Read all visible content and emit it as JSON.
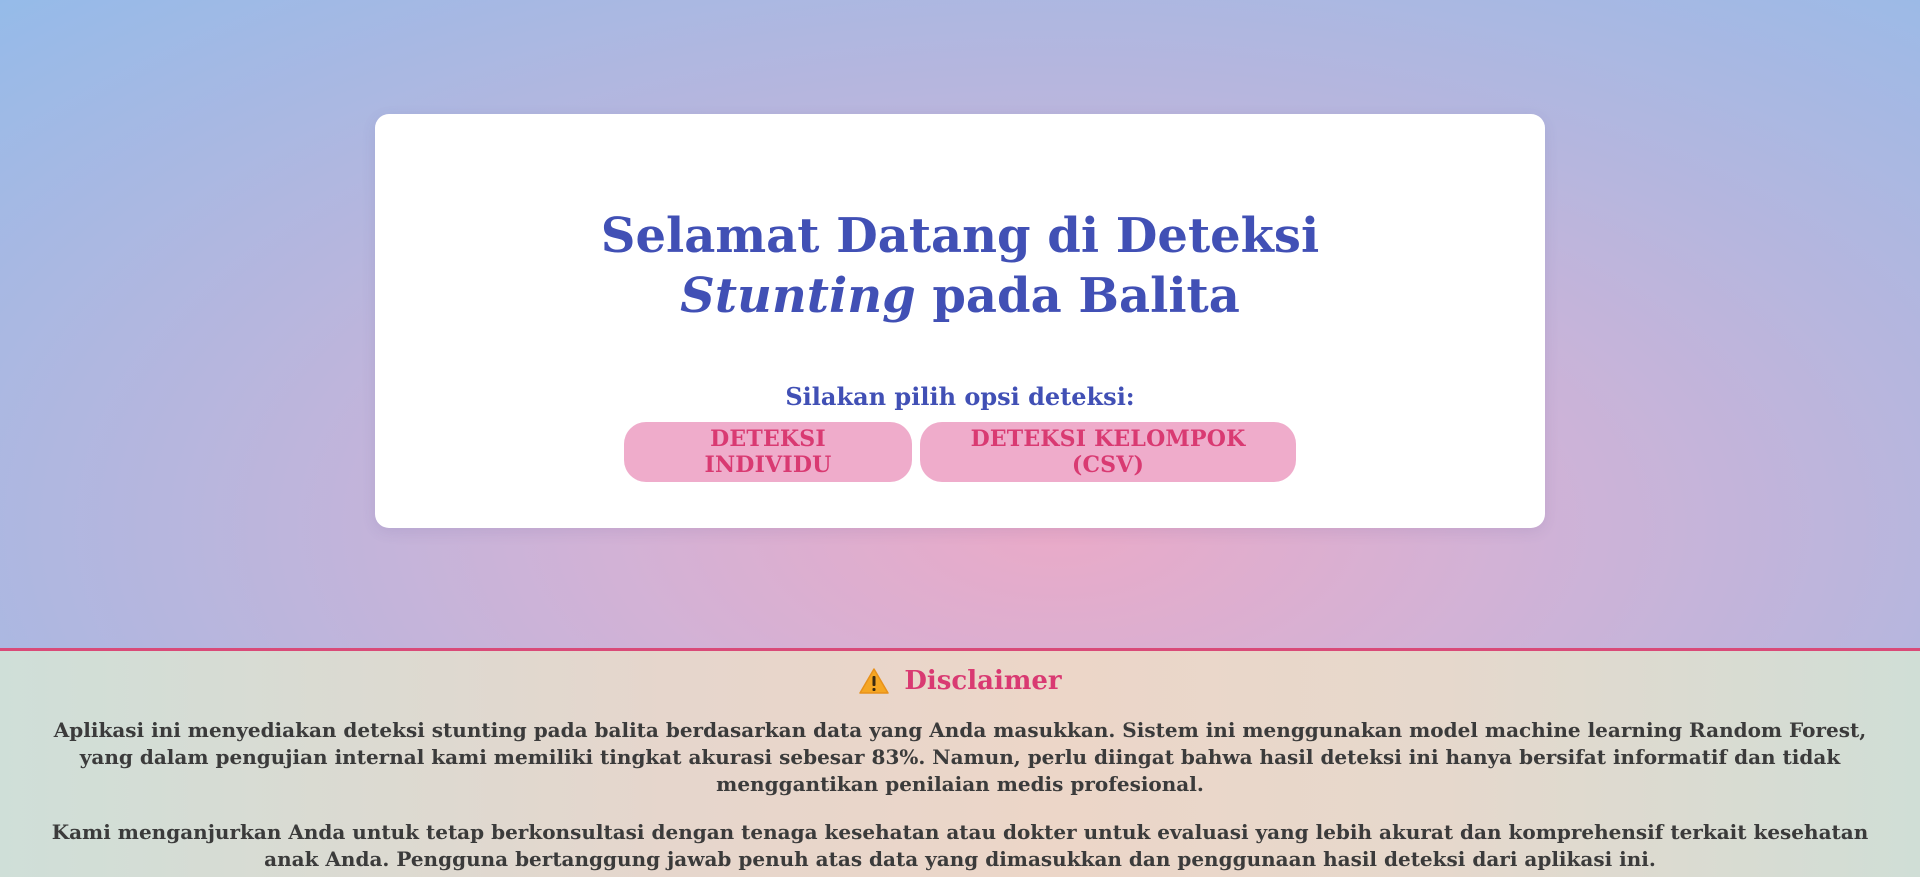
{
  "card": {
    "title_part1": "Selamat Datang di Deteksi ",
    "title_italic": "Stunting",
    "title_part2": " pada Balita",
    "subtitle": "Silakan pilih opsi deteksi:",
    "buttons": {
      "individu": "DETEKSI INDIVIDU",
      "kelompok": "DETEKSI KELOMPOK (CSV)"
    }
  },
  "disclaimer": {
    "icon": "warning-icon",
    "title": "Disclaimer",
    "paragraph1": "Aplikasi ini menyediakan deteksi stunting pada balita berdasarkan data yang Anda masukkan. Sistem ini menggunakan model machine learning Random Forest, yang dalam pengujian internal kami memiliki tingkat akurasi sebesar 83%. Namun, perlu diingat bahwa hasil deteksi ini hanya bersifat informatif dan tidak menggantikan penilaian medis profesional.",
    "paragraph2": "Kami menganjurkan Anda untuk tetap berkonsultasi dengan tenaga kesehatan atau dokter untuk evaluasi yang lebih akurat dan komprehensif terkait kesehatan anak Anda. Pengguna bertanggung jawab penuh atas data yang dimasukkan dan penggunaan hasil deteksi dari aplikasi ini."
  },
  "colors": {
    "accent_blue": "#4150b5",
    "accent_pink": "#d93a72",
    "button_bg": "#efaccb"
  }
}
